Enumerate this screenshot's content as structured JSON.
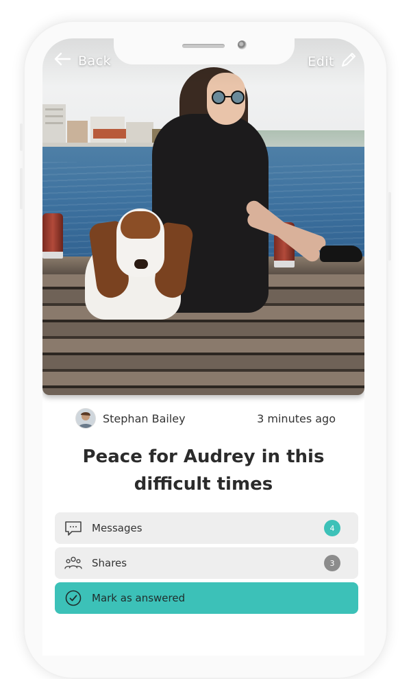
{
  "nav": {
    "back_label": "Back",
    "edit_label": "Edit"
  },
  "post": {
    "author": "Stephan Bailey",
    "time": "3 minutes ago",
    "title": "Peace for Audrey in this difficult times"
  },
  "actions": [
    {
      "label": "Messages",
      "count": "4",
      "icon": "chat-bubble-icon",
      "badge_color": "#3cc1b8"
    },
    {
      "label": "Shares",
      "count": "3",
      "icon": "people-group-icon",
      "badge_color": "#8c8c8c"
    },
    {
      "label": "Mark as answered",
      "icon": "check-circle-icon",
      "background": "#3cc1b8"
    }
  ]
}
